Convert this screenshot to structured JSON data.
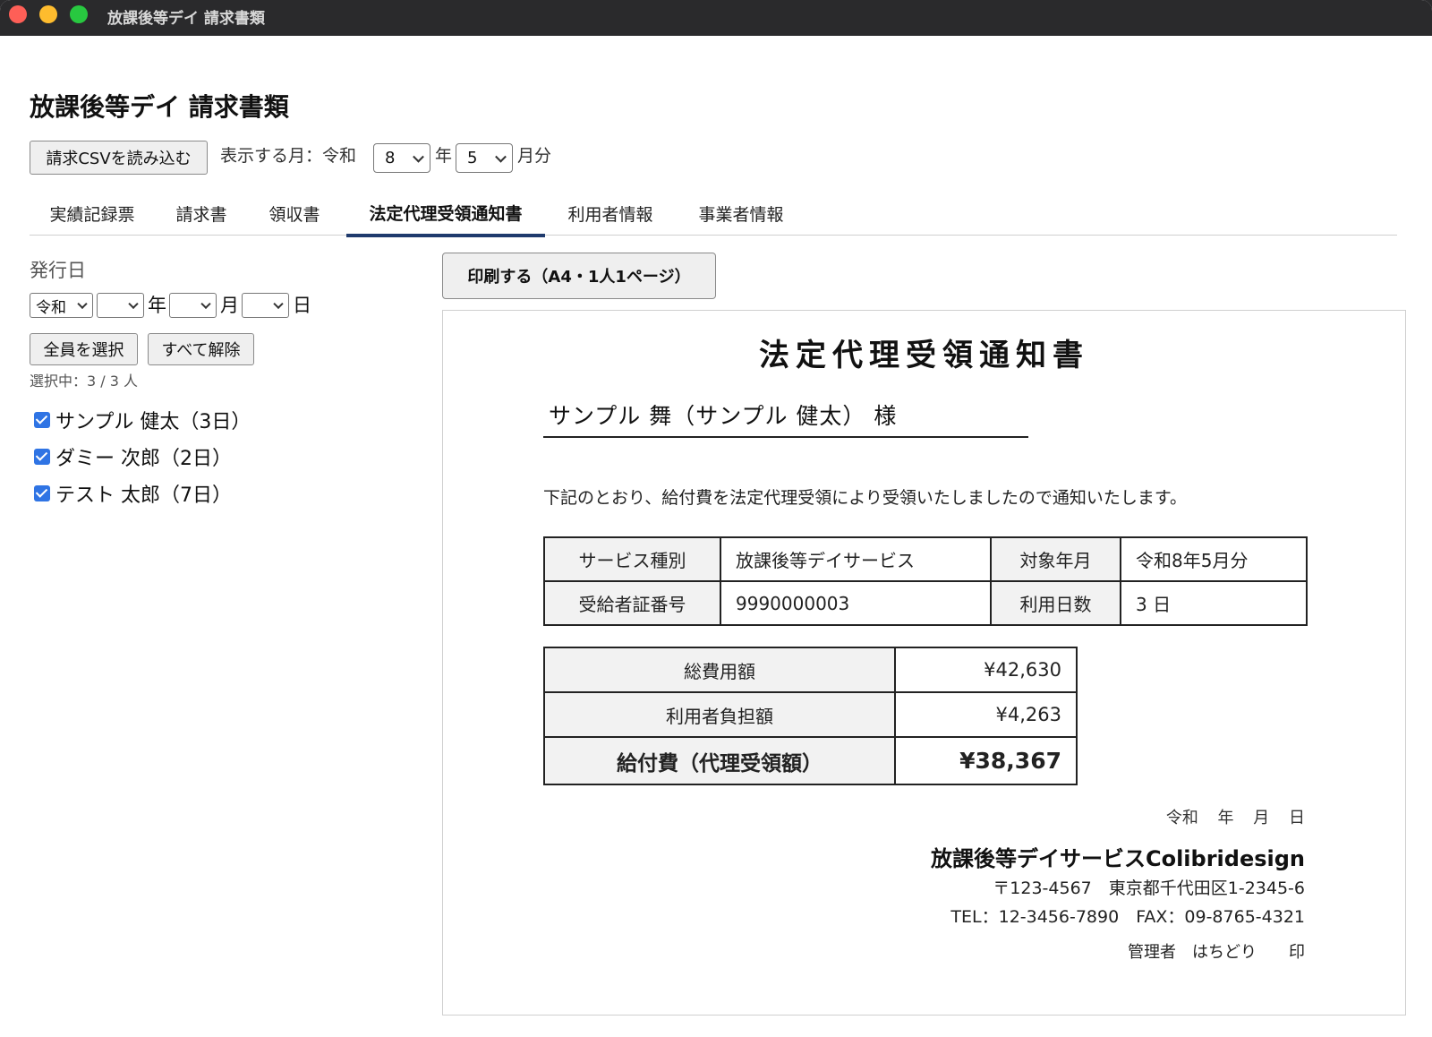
{
  "window": {
    "title": "放課後等デイ 請求書類"
  },
  "app": {
    "title": "放課後等デイ 請求書類"
  },
  "toolbar": {
    "csv_button": "請求CSVを読み込む",
    "month_label": "表示する月：令和",
    "year_value": "8",
    "year_suffix": "年",
    "month_value": "5",
    "month_suffix": "月分"
  },
  "tabs": [
    {
      "label": "実績記録票"
    },
    {
      "label": "請求書"
    },
    {
      "label": "領収書"
    },
    {
      "label": "法定代理受領通知書",
      "active": true
    },
    {
      "label": "利用者情報"
    },
    {
      "label": "事業者情報"
    }
  ],
  "sidebar": {
    "issue_date_label": "発行日",
    "era_value": "令和",
    "year_unit": "年",
    "month_unit": "月",
    "day_unit": "日",
    "select_all": "全員を選択",
    "clear_all": "すべて解除",
    "selected_count": "選択中：3 / 3 人",
    "people": [
      {
        "label": "サンプル 健太（3日）",
        "checked": true
      },
      {
        "label": "ダミー 次郎（2日）",
        "checked": true
      },
      {
        "label": "テスト 太郎（7日）",
        "checked": true
      }
    ]
  },
  "print_button": "印刷する（A4・1人1ページ）",
  "document": {
    "title": "法定代理受領通知書",
    "recipient": "サンプル 舞（サンプル 健太） 様",
    "notice": "下記のとおり、給付費を法定代理受領により受領いたしましたので通知いたします。",
    "info": {
      "service_type_label": "サービス種別",
      "service_type": "放課後等デイサービス",
      "period_label": "対象年月",
      "period": "令和8年5月分",
      "cert_label": "受給者証番号",
      "cert_number": "9990000003",
      "days_label": "利用日数",
      "days": "3 日"
    },
    "amounts": {
      "total_label": "総費用額",
      "total": "¥42,630",
      "user_label": "利用者負担額",
      "user": "¥4,263",
      "benefit_label": "給付費（代理受領額）",
      "benefit": "¥38,367"
    },
    "footer": {
      "date": "令和 年 月 日",
      "company": "放課後等デイサービスColibridesign",
      "address": "〒123-4567　東京都千代田区1-2345-6",
      "tel_fax": "TEL：12-3456-7890　FAX：09-8765-4321",
      "manager": "管理者　はちどり　　印"
    }
  },
  "colors": {
    "accent": "#1f3a6d",
    "checkbox": "#2f74e4",
    "titlebar": "#2a2a2c"
  }
}
